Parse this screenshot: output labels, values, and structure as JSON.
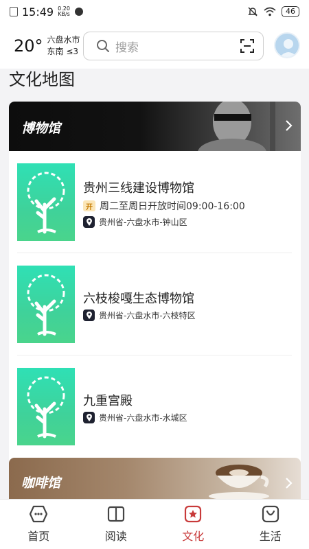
{
  "status_bar": {
    "time": "15:49",
    "net_speed_value": "0.20",
    "net_speed_unit": "KB/s",
    "battery": "46"
  },
  "header": {
    "temperature": "20°",
    "city": "六盘水市",
    "wind": "东南 ≤3",
    "search_placeholder": "搜索"
  },
  "page": {
    "section_title": "文化地图"
  },
  "museum_section": {
    "title": "博物馆",
    "items": [
      {
        "name": "贵州三线建设博物馆",
        "hours_badge": "开",
        "hours": "周二至周日开放时间09:00-16:00",
        "address": "贵州省-六盘水市-钟山区"
      },
      {
        "name": "六枝梭嘎生态博物馆",
        "address": "贵州省-六盘水市-六枝特区"
      },
      {
        "name": "九重宫殿",
        "address": "贵州省-六盘水市-水城区"
      }
    ]
  },
  "cafe_section": {
    "title": "咖啡馆"
  },
  "bottom_nav": {
    "items": [
      {
        "label": "首页",
        "icon": "home-icon"
      },
      {
        "label": "阅读",
        "icon": "book-icon"
      },
      {
        "label": "文化",
        "icon": "culture-star-icon",
        "active": true
      },
      {
        "label": "生活",
        "icon": "life-bag-icon"
      }
    ]
  },
  "colors": {
    "accent": "#c83a3a",
    "thumb_green": "#3fd29a",
    "banner_dark": "#111111"
  }
}
